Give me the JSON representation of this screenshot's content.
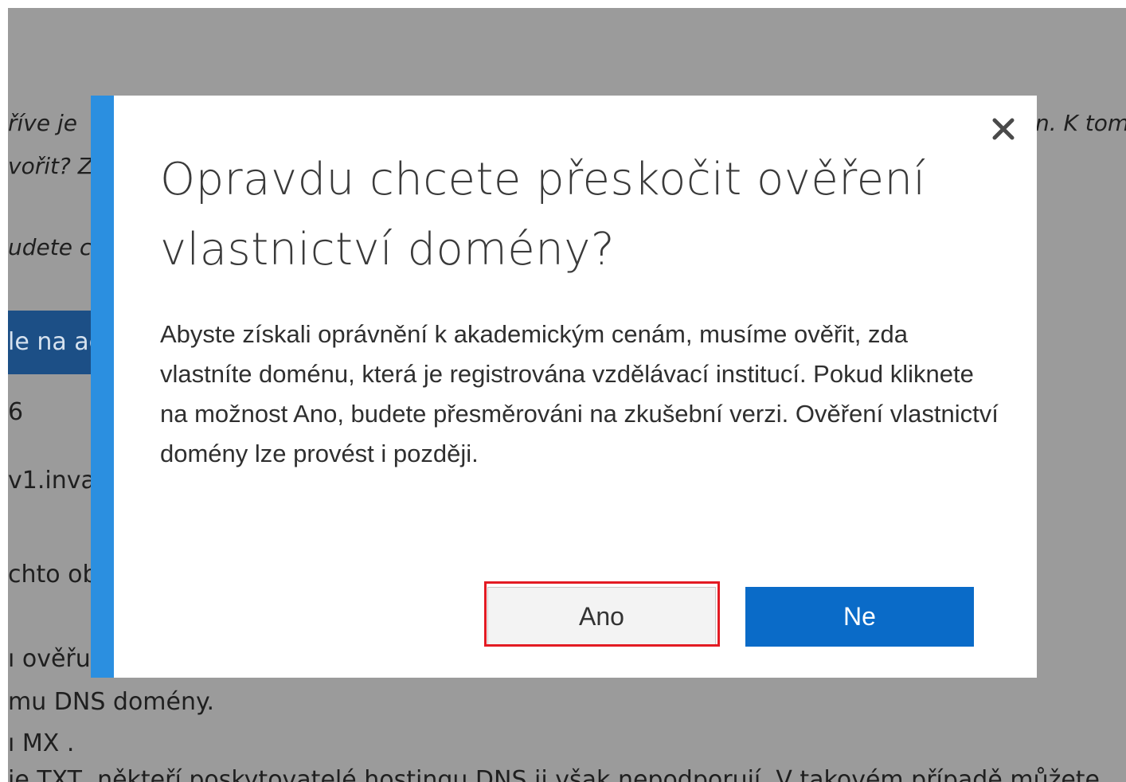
{
  "background": {
    "lines": [
      "říve je",
      "vořit? Z",
      "udete c",
      "le na ac",
      "6",
      "v1.inva",
      "chto ob",
      "ı ověřu",
      "mu DNS domény.",
      "ı MX .",
      "je TXT, někteří poskytovatelé hostingu DNS ji však nepodporují. V takovém případě můžete",
      "n. K tom"
    ]
  },
  "dialog": {
    "title": "Opravdu chcete přeskočit ověření vlastnictví domény?",
    "body": "Abyste získali oprávnění k akademickým cenám, musíme ověřit, zda vlastníte doménu, která je registrována vzdělávací institucí. Pokud kliknete na možnost Ano, budete přesměrováni na zkušební verzi. Ověření vlastnictví domény lze provést i později.",
    "yes_label": "Ano",
    "no_label": "Ne",
    "close_icon": "close-icon"
  },
  "colors": {
    "accent": "#2b8fe0",
    "primary_button": "#0a6bc8",
    "highlight": "#e31b23"
  }
}
